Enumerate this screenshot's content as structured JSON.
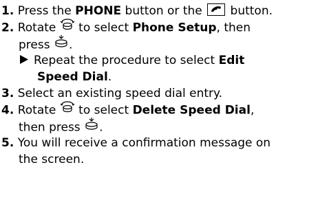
{
  "steps": [
    {
      "num": "1.",
      "p1": "Press the ",
      "b1": "PHONE",
      "p2": " button or the ",
      "p3": " button."
    },
    {
      "num": "2.",
      "p1": "Rotate ",
      "p2": " to select ",
      "b1": "Phone Setup",
      "p3": ", then",
      "p4": "press ",
      "p5": ".",
      "sub": {
        "p1": "Repeat the procedure to select ",
        "b1": "Edit",
        "b2": "Speed Dial",
        "p2": "."
      }
    },
    {
      "num": "3.",
      "text": "Select an existing speed dial entry."
    },
    {
      "num": "4.",
      "p1": "Rotate ",
      "p2": " to select ",
      "b1": "Delete Speed Dial",
      "p3": ",",
      "p4": "then press ",
      "p5": "."
    },
    {
      "num": "5.",
      "p1": "You will receive a confirmation message on",
      "p2": "the screen."
    }
  ],
  "icons": {
    "phone_button": "phone-handset-icon",
    "selector_knob": "interface-dial-rotate-icon",
    "enter_press": "interface-dial-press-icon",
    "sub_step": "triangle-arrow-icon"
  }
}
